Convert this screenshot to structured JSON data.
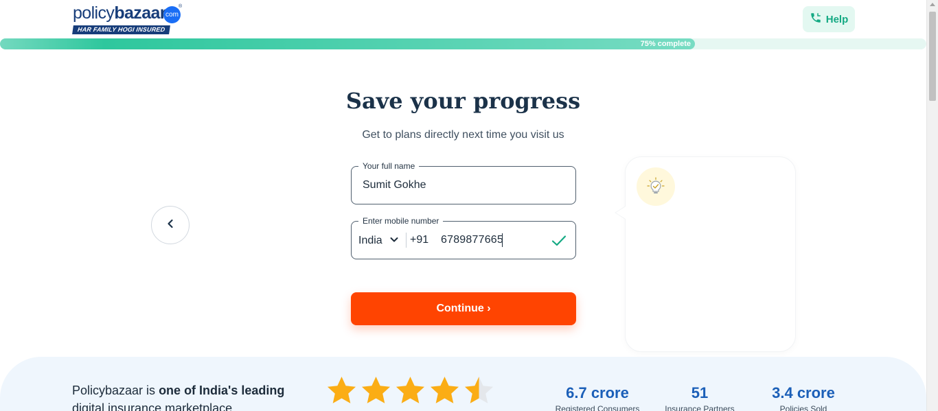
{
  "header": {
    "logo": {
      "word_light": "policy",
      "word_bold": "bazaar",
      "badge": "com",
      "registered": "®",
      "tagline": "HAR FAMILY HOGI INSURED"
    },
    "help_label": "Help"
  },
  "progress": {
    "label": "75% complete",
    "value_percent": 75
  },
  "main": {
    "title": "Save your progress",
    "subtitle": "Get to plans directly next time you visit us",
    "name_field": {
      "label": "Your full name",
      "value": "Sumit Gokhe"
    },
    "mobile_field": {
      "label": "Enter mobile number",
      "country": "India",
      "dial_code": "+91",
      "value": "6789877665"
    },
    "continue_label": "Continue ›"
  },
  "footer": {
    "text_prefix": "Policybazaar is ",
    "text_strong": "one of India's leading",
    "text_suffix": " digital insurance marketplace",
    "rating_stars": 4.5,
    "stats": [
      {
        "value": "6.7 crore",
        "label": "Registered Consumers"
      },
      {
        "value": "51",
        "label": "Insurance Partners"
      },
      {
        "value": "3.4 crore",
        "label": "Policies Sold"
      }
    ]
  },
  "colors": {
    "accent": "#ff4401",
    "brand": "#173d7a",
    "success": "#14a983",
    "progress": "#2ec79d"
  }
}
